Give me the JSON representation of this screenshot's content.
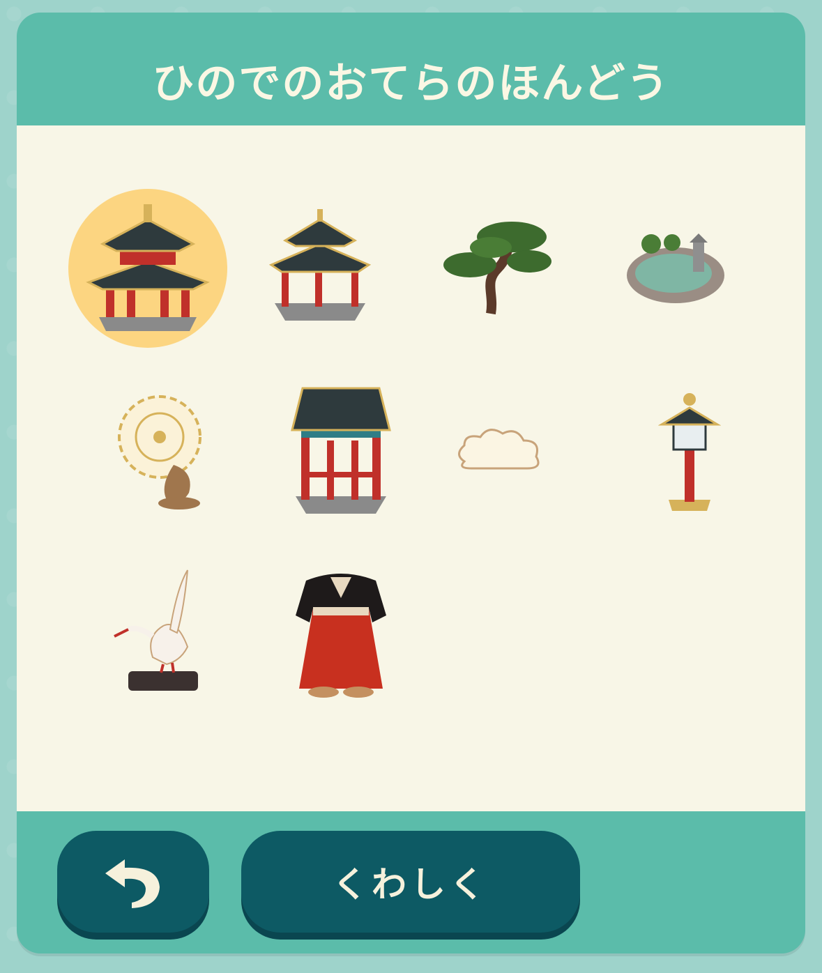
{
  "panel": {
    "title": "ひのでのおてらのほんどう"
  },
  "items": [
    {
      "icon": "temple-main-hall-icon",
      "selected": true
    },
    {
      "icon": "pavilion-icon",
      "selected": false
    },
    {
      "icon": "pine-tree-icon",
      "selected": false
    },
    {
      "icon": "stone-pond-icon",
      "selected": false
    },
    {
      "icon": "halo-statue-icon",
      "selected": false
    },
    {
      "icon": "bell-gate-icon",
      "selected": false
    },
    {
      "icon": "cloud-icon",
      "selected": false
    },
    {
      "icon": "stone-lantern-icon",
      "selected": false
    },
    {
      "icon": "crane-on-log-icon",
      "selected": false
    },
    {
      "icon": "hakama-kimono-icon",
      "selected": false
    }
  ],
  "footer": {
    "back_icon": "undo-arrow-icon",
    "detail_label": "くわしく"
  },
  "colors": {
    "panel": "#5bbcaa",
    "content": "#f8f6e7",
    "button": "#0d5a64",
    "selected_highlight": "#fcd581",
    "title_text": "#fbf7e4"
  }
}
